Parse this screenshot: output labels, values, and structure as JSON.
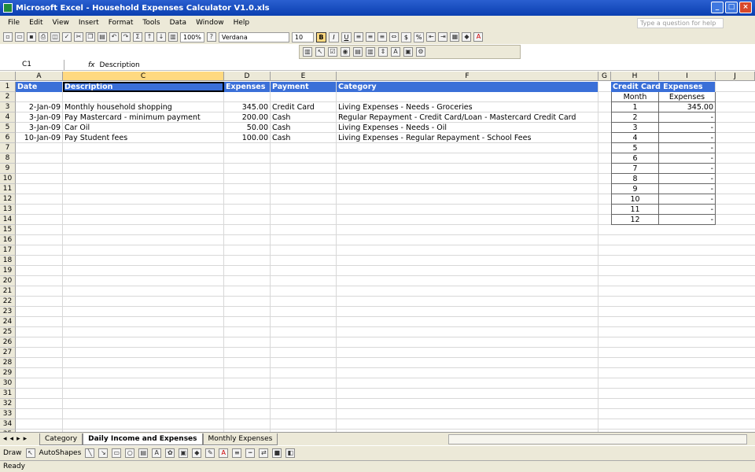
{
  "window": {
    "title": "Microsoft Excel - Household Expenses Calculator V1.0.xls"
  },
  "menu": {
    "items": [
      "File",
      "Edit",
      "View",
      "Insert",
      "Format",
      "Tools",
      "Data",
      "Window",
      "Help"
    ],
    "ask_placeholder": "Type a question for help"
  },
  "toolbar": {
    "zoom": "100%",
    "font": "Verdana",
    "size": "10",
    "bold": "B",
    "italic": "I",
    "underline": "U",
    "currency": "$",
    "percent": "%"
  },
  "formula": {
    "namebox": "C1",
    "fx": "fx",
    "content": "Description"
  },
  "columns": [
    "A",
    "C",
    "D",
    "E",
    "F",
    "G",
    "H",
    "I",
    "J"
  ],
  "main_table": {
    "headers": {
      "date": "Date",
      "description": "Description",
      "expenses": "Expenses",
      "payment": "Payment",
      "category": "Category"
    },
    "rows": [
      {
        "date": "2-Jan-09",
        "description": "Monthly household shopping",
        "expenses": "345.00",
        "payment": "Credit Card",
        "category": "Living Expenses - Needs - Groceries"
      },
      {
        "date": "3-Jan-09",
        "description": "Pay Mastercard - minimum payment",
        "expenses": "200.00",
        "payment": "Cash",
        "category": "Regular Repayment - Credit Card/Loan - Mastercard Credit Card"
      },
      {
        "date": "3-Jan-09",
        "description": "Car Oil",
        "expenses": "50.00",
        "payment": "Cash",
        "category": "Living Expenses - Needs - Oil"
      },
      {
        "date": "10-Jan-09",
        "description": "Pay Student fees",
        "expenses": "100.00",
        "payment": "Cash",
        "category": "Living Expenses - Regular Repayment - School Fees"
      }
    ]
  },
  "cc_table": {
    "title": "Credit Card Expenses",
    "month_label": "Month",
    "expenses_label": "Expenses",
    "rows": [
      {
        "month": "1",
        "value": "345.00"
      },
      {
        "month": "2",
        "value": "-"
      },
      {
        "month": "3",
        "value": "-"
      },
      {
        "month": "4",
        "value": "-"
      },
      {
        "month": "5",
        "value": "-"
      },
      {
        "month": "6",
        "value": "-"
      },
      {
        "month": "7",
        "value": "-"
      },
      {
        "month": "8",
        "value": "-"
      },
      {
        "month": "9",
        "value": "-"
      },
      {
        "month": "10",
        "value": "-"
      },
      {
        "month": "11",
        "value": "-"
      },
      {
        "month": "12",
        "value": "-"
      }
    ]
  },
  "row_count": 35,
  "tabs": [
    "Category",
    "Daily Income and Expenses",
    "Monthly Expenses"
  ],
  "active_tab": "Daily Income and Expenses",
  "drawbar": {
    "draw": "Draw",
    "autoshapes": "AutoShapes"
  },
  "status": "Ready"
}
